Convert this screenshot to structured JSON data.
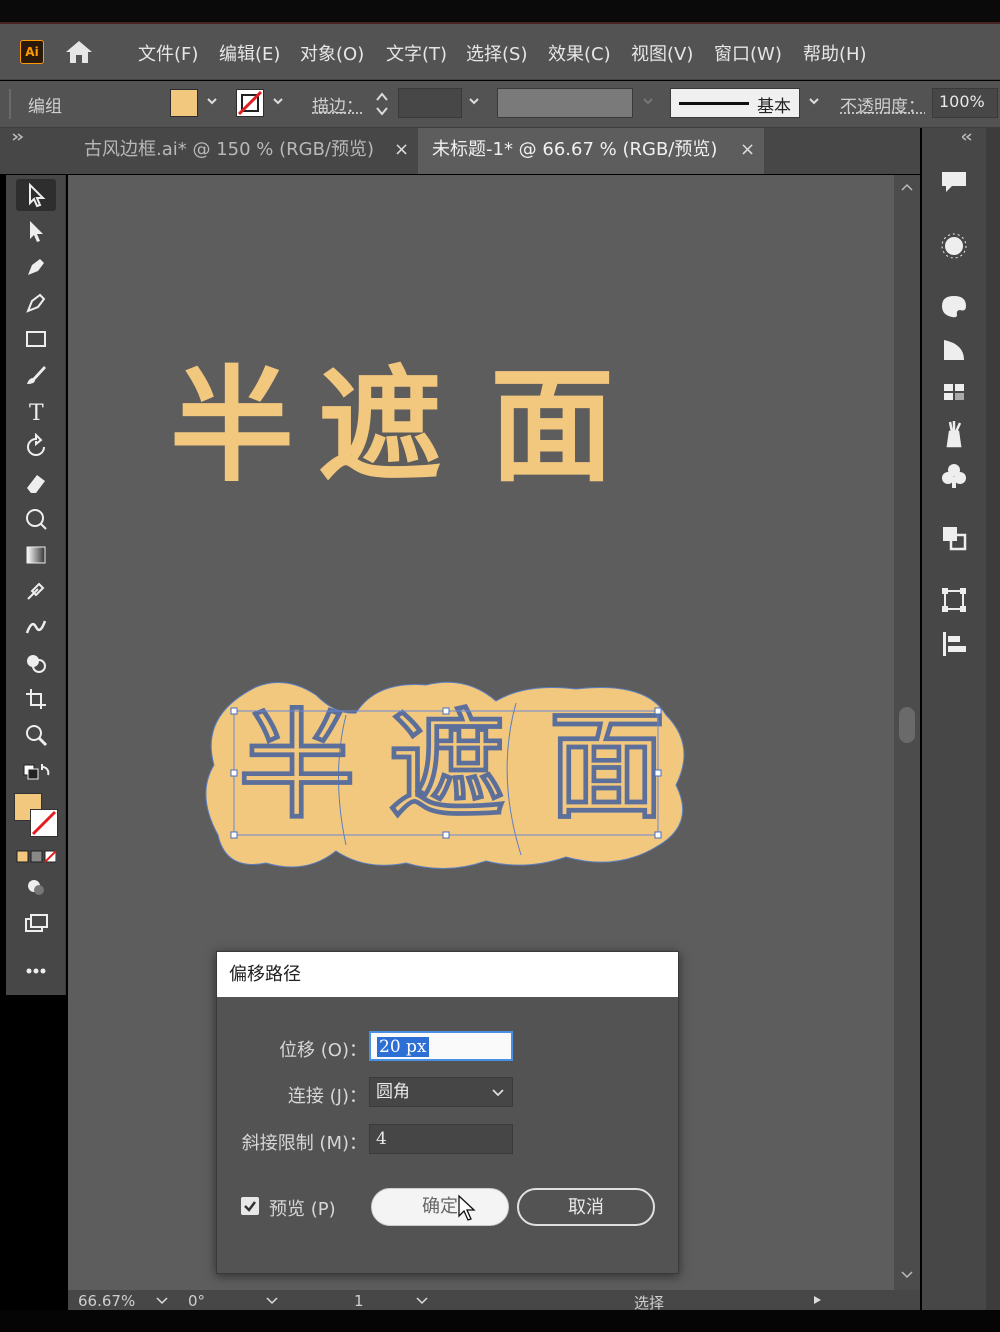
{
  "app": {
    "logo": "Ai",
    "accent_color": "#ff9a00"
  },
  "menu": {
    "items": [
      "文件(F)",
      "编辑(E)",
      "对象(O)",
      "文字(T)",
      "选择(S)",
      "效果(C)",
      "视图(V)",
      "窗口(W)",
      "帮助(H)"
    ]
  },
  "control_bar": {
    "selection_label": "编组",
    "fill_color": "#f2c77e",
    "stroke_label": "描边：",
    "stroke_style": "基本",
    "opacity_label": "不透明度：",
    "opacity_value": "100%"
  },
  "tabs": [
    {
      "label": "古风边框.ai* @ 150 % (RGB/预览)",
      "close": "×",
      "active": false
    },
    {
      "label": "未标题-1* @ 66.67 % (RGB/预览)",
      "close": "×",
      "active": true
    }
  ],
  "canvas": {
    "title_chars": [
      "半",
      "遮",
      "面"
    ],
    "outlined_chars": [
      "半",
      "遮",
      "面"
    ],
    "text_color": "#f2c77e"
  },
  "dialog": {
    "title": "偏移路径",
    "offset_label": "位移 (O)：",
    "offset_value": "20 px",
    "joins_label": "连接 (J)：",
    "joins_value": "圆角",
    "miter_label": "斜接限制 (M)：",
    "miter_value": "4",
    "preview_label": "预览 (P)",
    "preview_checked": true,
    "ok_label": "确定",
    "cancel_label": "取消"
  },
  "status": {
    "zoom": "66.67%",
    "rotation": "0°",
    "artboard": "1",
    "mode": "选择"
  }
}
